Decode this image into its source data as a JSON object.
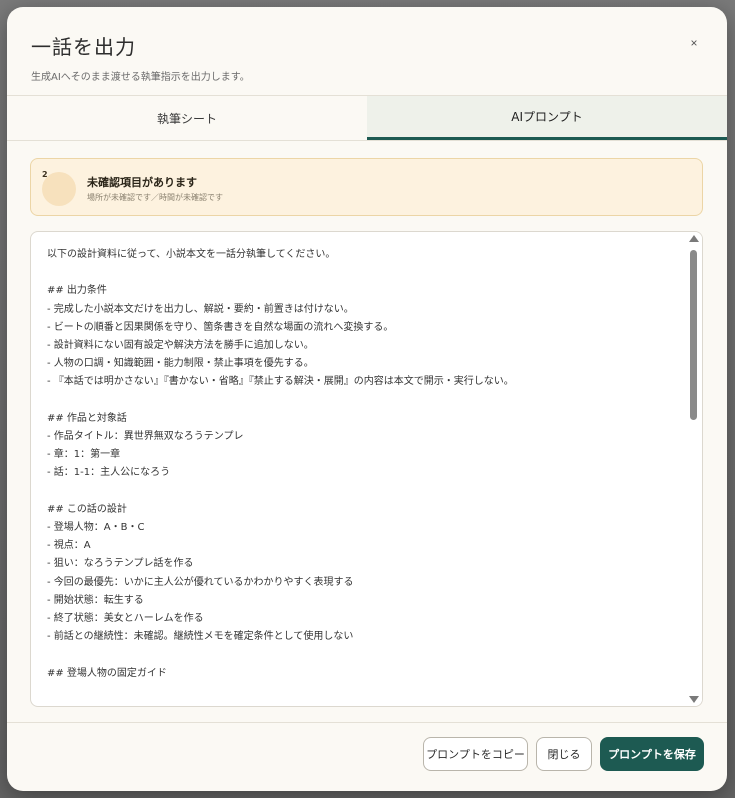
{
  "dialog": {
    "title": "一話を出力",
    "subtitle": "生成AIへそのまま渡せる執筆指示を出力します。",
    "close_label": "×"
  },
  "tabs": [
    {
      "label": "執筆シート",
      "active": false
    },
    {
      "label": "AIプロンプト",
      "active": true
    }
  ],
  "warning": {
    "count": "2",
    "title": "未確認項目があります",
    "detail": "場所が未確認です／時間が未確認です"
  },
  "prompt": {
    "text": "以下の設計資料に従って、小説本文を一話分執筆してください。\n\n## 出力条件\n- 完成した小説本文だけを出力し、解説・要約・前置きは付けない。\n- ビートの順番と因果関係を守り、箇条書きを自然な場面の流れへ変換する。\n- 設計資料にない固有設定や解決方法を勝手に追加しない。\n- 人物の口調・知識範囲・能力制限・禁止事項を優先する。\n- 『本話では明かさない』『書かない・省略』『禁止する解決・展開』の内容は本文で開示・実行しない。\n\n## 作品と対象話\n- 作品タイトル：異世界無双なろうテンプレ\n- 章：1：第一章\n- 話：1-1：主人公になろう\n\n## この話の設計\n- 登場人物：A・B・C\n- 視点：A\n- 狙い：なろうテンプレ話を作る\n- 今回の最優先：いかに主人公が優れているかわかりやすく表現する\n- 開始状態：転生する\n- 終了状態：美女とハーレムを作る\n- 前話との継続性：未確認。継続性メモを確定条件として使用しない\n\n## 登場人物の固定ガイド"
  },
  "footer": {
    "copy_label": "プロンプトをコピー",
    "close_label": "閉じる",
    "save_label": "プロンプトを保存"
  },
  "colors": {
    "accent": "#1d5a52",
    "warning_bg": "#fdf2df",
    "modal_bg": "#fbf9f4"
  }
}
